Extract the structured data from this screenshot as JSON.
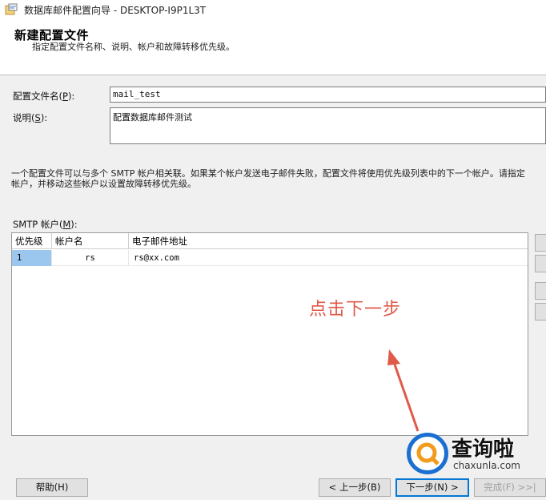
{
  "window": {
    "title": "数据库邮件配置向导 - DESKTOP-I9P1L3T"
  },
  "header": {
    "title": "新建配置文件",
    "subtitle": "指定配置文件名称、说明、帐户和故障转移优先级。"
  },
  "profile": {
    "name_label_pre": "配置文件名(",
    "name_label_key": "P",
    "name_label_post": "):",
    "name_value": "mail_test",
    "desc_label_pre": "说明(",
    "desc_label_key": "S",
    "desc_label_post": "):",
    "desc_value": "配置数据库邮件测试"
  },
  "info_text": {
    "line1": "一个配置文件可以与多个 SMTP 帐户相关联。如果某个帐户发送电子邮件失败，配置文件将使用优先级列表中的下一个帐户。请指定",
    "line2": "帐户，并移动这些帐户以设置故障转移优先级。"
  },
  "smtp": {
    "label_pre": "SMTP 帐户(",
    "label_key": "M",
    "label_post": "):",
    "columns": [
      "优先级",
      "帐户名",
      "电子邮件地址"
    ],
    "rows": [
      {
        "priority": "1",
        "account": "rs",
        "email": "rs@xx.com"
      }
    ]
  },
  "annotation": {
    "text": "点击下一步",
    "color": "#e05a4a"
  },
  "buttons": {
    "help": "帮助(H)",
    "back": "< 上一步(B)",
    "next": "下一步(N) >",
    "finish": "完成(F) >>|"
  },
  "watermark": {
    "name": "查询啦",
    "domain": "chaxunla.com",
    "color": "#1a6fd1"
  }
}
